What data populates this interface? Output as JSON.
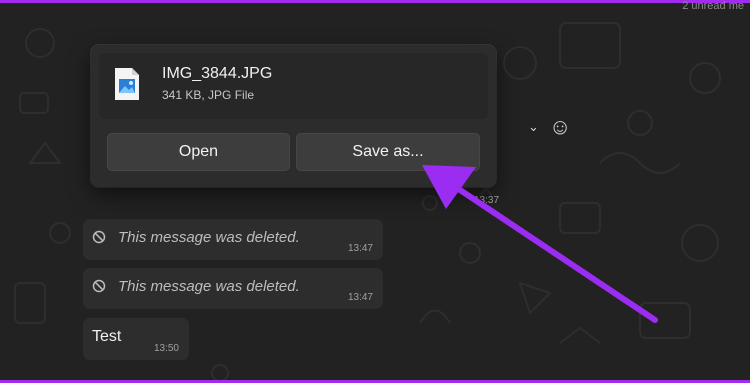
{
  "header": {
    "topright_fragment": "2 unread me"
  },
  "popup": {
    "file_name": "IMG_3844.JPG",
    "file_meta": "341 KB, JPG File",
    "open_label": "Open",
    "save_label": "Save as..."
  },
  "reply_tools": {
    "chevron": "⌄",
    "emoji": "☺"
  },
  "behind_time": "13:37",
  "messages": [
    {
      "text": "This message was deleted.",
      "time": "13:47"
    },
    {
      "text": "This message was deleted.",
      "time": "13:47"
    },
    {
      "text": "Test",
      "time": "13:50"
    }
  ],
  "colors": {
    "annotation_arrow": "#9b2cf2",
    "frame_border": "#a12cf0",
    "background": "#222222"
  },
  "icons": [
    "image-file-icon",
    "deleted-message-icon",
    "emoji-icon",
    "chevron-down-icon"
  ]
}
